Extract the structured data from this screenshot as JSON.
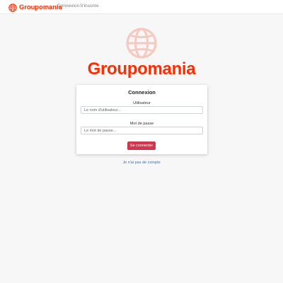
{
  "colors": {
    "brand": "#fd2d01",
    "brand_light": "#f6c9c0",
    "button": "#d1364e",
    "link": "#4a6fa5",
    "background": "#f7f7f7"
  },
  "navbar": {
    "brand_icon": "globe-icon",
    "brand_name": "Groupomania",
    "links": [
      {
        "label": "Connexion"
      },
      {
        "label": "S'inscrire"
      }
    ]
  },
  "hero": {
    "icon": "globe-icon",
    "title": "Groupomania"
  },
  "login_card": {
    "title": "Connexion",
    "username": {
      "label": "Utilisateur",
      "placeholder": "Le nom d'utilisateur...",
      "value": ""
    },
    "password": {
      "label": "Mot de passe",
      "placeholder": "Le mot de passe...",
      "value": ""
    },
    "submit_label": "Se connecter"
  },
  "no_account_link": "Je n'ai pas de compte"
}
